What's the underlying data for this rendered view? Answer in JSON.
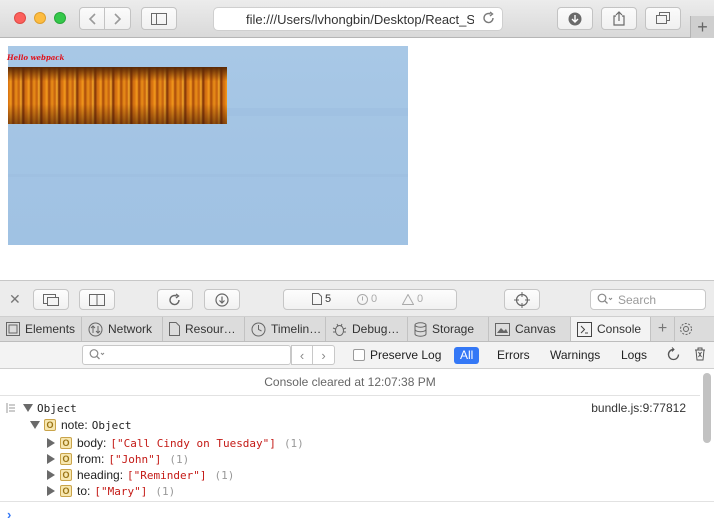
{
  "browser": {
    "address": "file:///Users/lvhongbin/Desktop/React_S"
  },
  "page": {
    "overlay_text": "Hello webpack"
  },
  "inspector": {
    "counts": {
      "resources": "5",
      "errors": "0",
      "warnings": "0"
    },
    "search_placeholder": "Search",
    "tabs": [
      {
        "label": "Elements",
        "icon": "elements-icon"
      },
      {
        "label": "Network",
        "icon": "network-icon"
      },
      {
        "label": "Resour…",
        "icon": "resources-icon"
      },
      {
        "label": "Timelin…",
        "icon": "timelines-icon"
      },
      {
        "label": "Debug…",
        "icon": "debugger-icon"
      },
      {
        "label": "Storage",
        "icon": "storage-icon"
      },
      {
        "label": "Canvas",
        "icon": "canvas-icon"
      },
      {
        "label": "Console",
        "icon": "console-icon"
      }
    ],
    "active_tab": "Console"
  },
  "console_filters": {
    "preserve_log": "Preserve Log",
    "all": "All",
    "errors": "Errors",
    "warnings": "Warnings",
    "logs": "Logs"
  },
  "console": {
    "cleared_message": "Console cleared at 12:07:38 PM",
    "source": "bundle.js:9:77812",
    "root": "Object",
    "note_key": "note:",
    "note_type": "Object",
    "type_badge": "O",
    "props": [
      {
        "key": "body:",
        "value": "[\"Call Cindy on Tuesday\"]",
        "count": "(1)"
      },
      {
        "key": "from:",
        "value": "[\"John\"]",
        "count": "(1)"
      },
      {
        "key": "heading:",
        "value": "[\"Reminder\"]",
        "count": "(1)"
      },
      {
        "key": "to:",
        "value": "[\"Mary\"]",
        "count": "(1)"
      }
    ]
  },
  "colors": {
    "accent": "#3478f6",
    "string_value": "#c41a16",
    "sky": "#a5c6e5"
  }
}
